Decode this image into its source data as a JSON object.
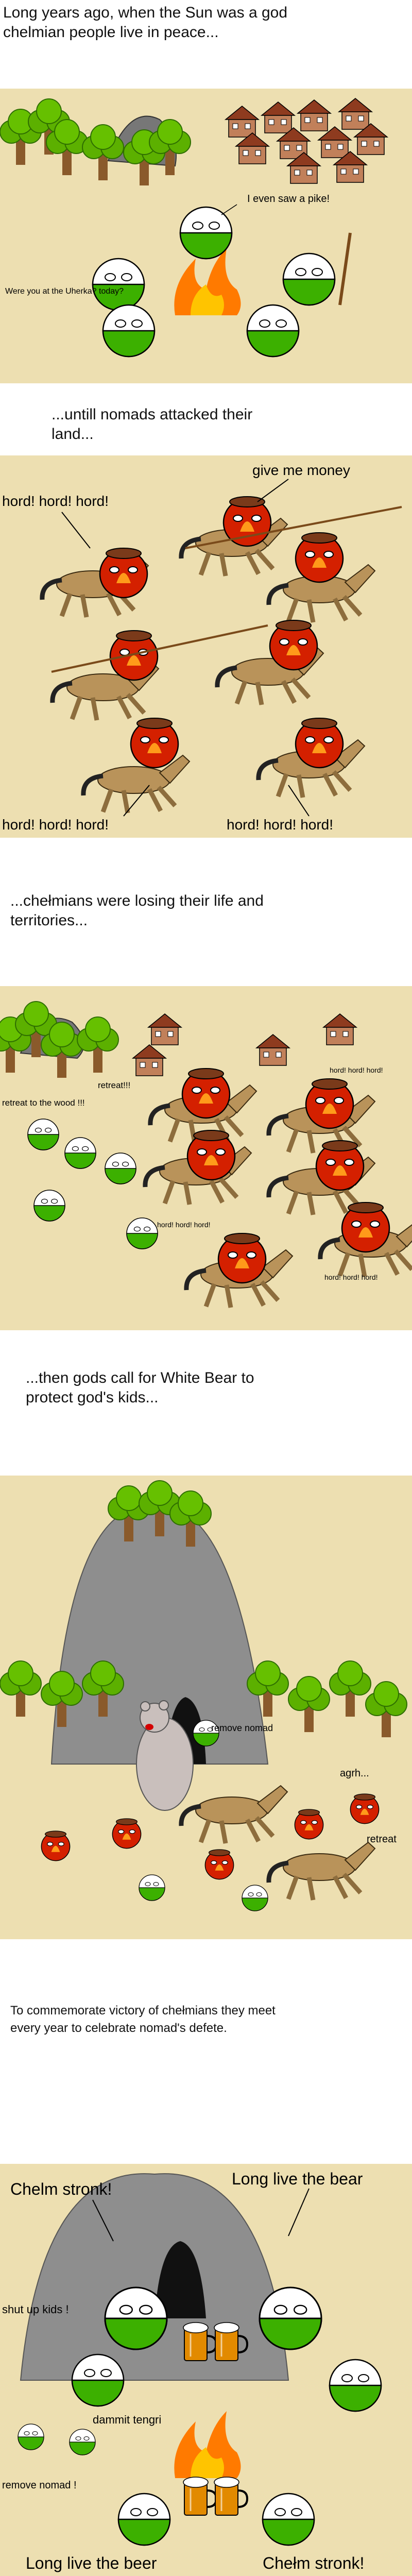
{
  "captions": {
    "c1_line1": "Long years ago, when the Sun was a god",
    "c1_line2": "chelmian people live in peace...",
    "c2_line1": "...untill nomads attacked their",
    "c2_line2": "land...",
    "c3_line1": "...chełmians were losing their life and",
    "c3_line2": "territories...",
    "c4_line1": "...then gods call for White Bear to",
    "c4_line2": "protect god's kids...",
    "c5_line1": "To commemorate victory of chełmians they meet",
    "c5_line2": "every year to celebrate nomad's defete."
  },
  "panel1": {
    "speech_pike": "I even saw a pike!",
    "speech_uherka": "Were you at the Uherka? today?"
  },
  "panel2": {
    "give_money": "give me money",
    "hord_top_left": "hord! hord! hord!",
    "hord_bottom_left": "hord! hord! hord!",
    "hord_bottom_right": "hord! hord! hord!"
  },
  "panel3": {
    "retreat": "retreat!!!",
    "retreat_wood": "retreat to the wood !!!",
    "hord_top": "hord! hord! hord!",
    "hord_mid": "hord! hord! hord!",
    "hord_right": "hord! hord! hord!"
  },
  "panel4": {
    "remove_nomad": "remove nomad",
    "agrh": "agrh...",
    "retreat": "retreat"
  },
  "panel5": {
    "chelm_stronk_left": "Chelm stronk!",
    "long_live_bear": "Long live the bear",
    "shut_up": "shut up kids !",
    "dammit": "dammit tengri",
    "remove_nomad": "remove nomad !",
    "long_live_beer": "Long live the beer",
    "chelm_stronk_right": "Chełm stronk!"
  },
  "colors": {
    "panel_bg": "#eddfb1",
    "ball_green": "#3cb000",
    "nomad_red": "#d42000",
    "horse": "#b9935a",
    "tree": "#5cb000",
    "cave": "#8e8e8e",
    "house": "#c1805a",
    "fire": "#ff7a00"
  },
  "icons": [
    "oak-tree-icon",
    "rock-icon",
    "house-icon",
    "chelmian-ball-icon",
    "nomad-ball-icon",
    "horse-icon",
    "bonfire-icon",
    "beer-mug-icon",
    "white-bear-icon",
    "cave-icon",
    "spear-icon",
    "flag-pole-icon"
  ]
}
